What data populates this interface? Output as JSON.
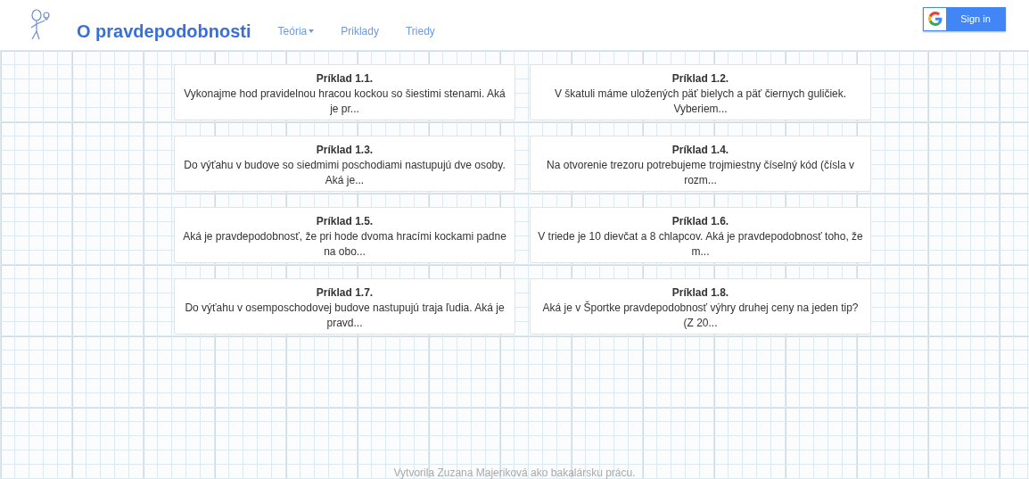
{
  "header": {
    "brand": "O pravdepodobnosti",
    "nav": [
      {
        "label": "Teória",
        "dropdown": true
      },
      {
        "label": "Priklady",
        "dropdown": false
      },
      {
        "label": "Triedy",
        "dropdown": false
      }
    ],
    "sign_in": "Sign in"
  },
  "examples": [
    {
      "title": "Príklad 1.1.",
      "text": "Vykonajme hod pravidelnou hracou kockou so šiestimi stenami. Aká je pr..."
    },
    {
      "title": "Príklad 1.2.",
      "text": "V škatuli máme uložených päť bielych a päť čiernych guličiek. Vyberiem..."
    },
    {
      "title": "Príklad 1.3.",
      "text": "Do výťahu v budove so siedmimi poschodiami nastupujú dve osoby. Aká je..."
    },
    {
      "title": "Príklad 1.4.",
      "text": "Na otvorenie trezoru potrebujeme trojmiestny číselný kód (čísla v rozm..."
    },
    {
      "title": "Príklad 1.5.",
      "text": "Aká je pravdepodobnosť, že pri hode dvoma hracími kockami padne na obo..."
    },
    {
      "title": "Príklad 1.6.",
      "text": "V triede je 10 dievčat a 8 chlapcov. Aká je pravdepodobnosť toho, že m..."
    },
    {
      "title": "Príklad 1.7.",
      "text": "Do výťahu v osemposchodovej budove nastupujú traja ľudia. Aká je pravd..."
    },
    {
      "title": "Príklad 1.8.",
      "text": "Aká je v Športke pravdepodobnosť výhry druhej ceny na jeden tip? (Z 20..."
    }
  ],
  "footer": "Vytvorila Zuzana Majeriková ako bakalársku prácu."
}
